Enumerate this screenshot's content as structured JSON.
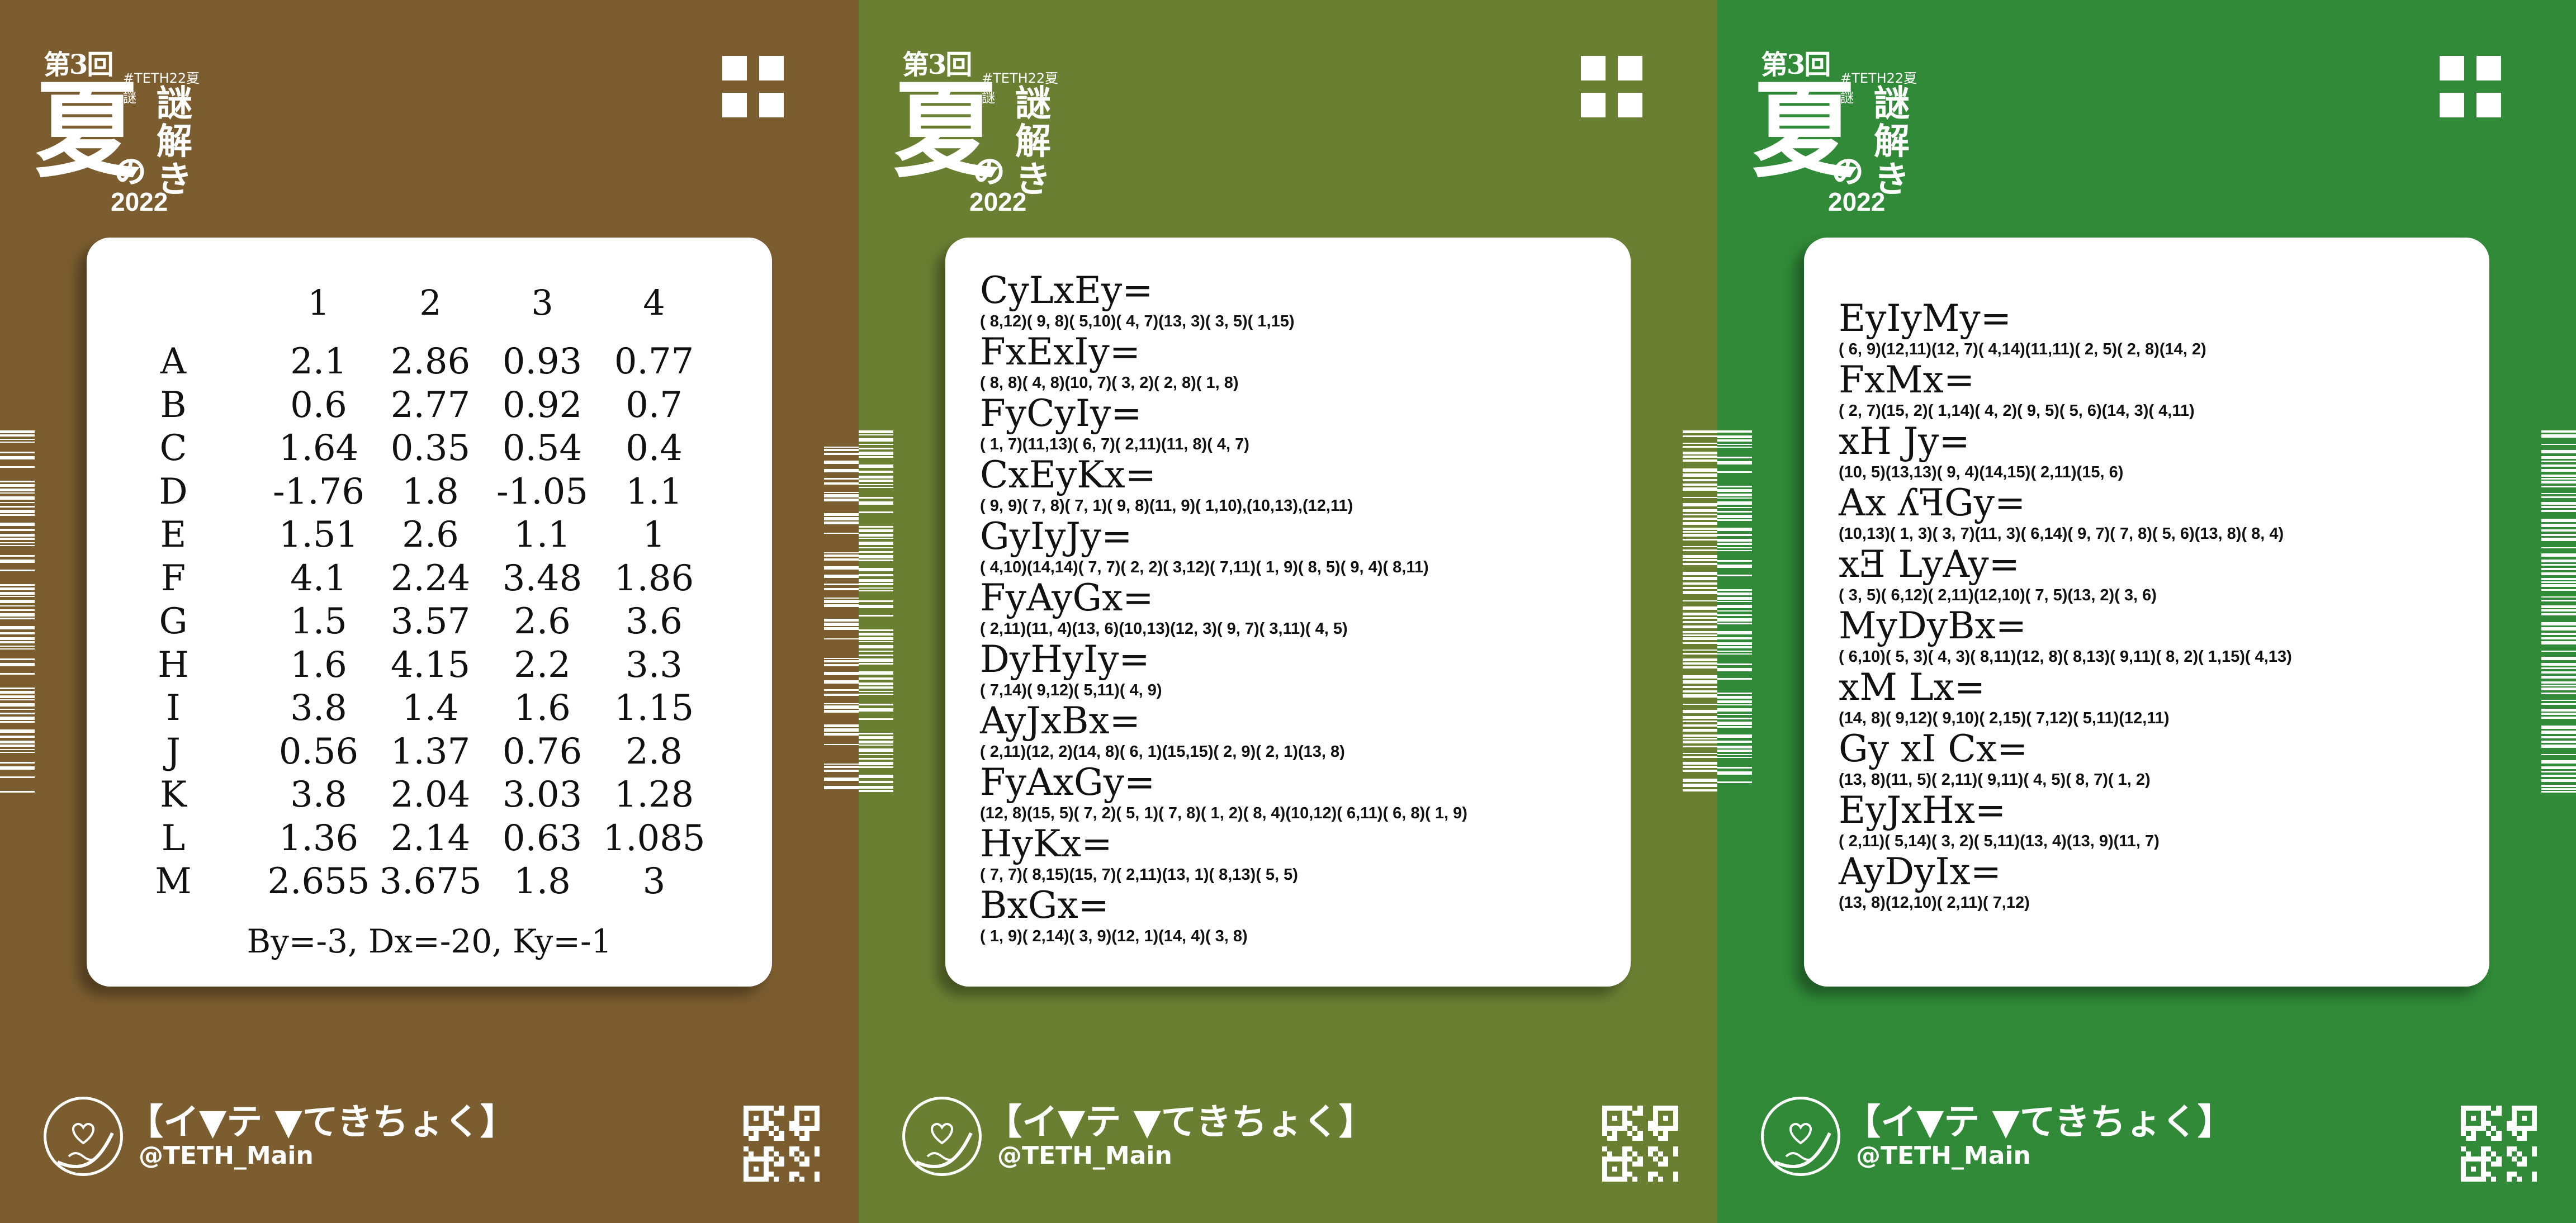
{
  "colors": {
    "card1_bg": "#7b5d30",
    "card2_bg": "#6b7f33",
    "card3_bg": "#308a38"
  },
  "brand": {
    "dai": "第3回",
    "tag": "#TETH22夏謎",
    "natsu": "夏",
    "no": "の",
    "nazo": [
      "謎",
      "解",
      "き"
    ],
    "year": "2022",
    "footer_title": "【イ▼テ ▼てきちょく】",
    "footer_handle": "@TETH_Main"
  },
  "icons": {
    "grid": "grid-icon",
    "badge": "heart-infinity-badge-icon",
    "qr": "qr-code-icon",
    "barcode": "barcode-strip-icon"
  },
  "card1": {
    "columns": [
      "1",
      "2",
      "3",
      "4"
    ],
    "rows": [
      {
        "label": "A",
        "values": [
          "2.1",
          "2.86",
          "0.93",
          "0.77"
        ]
      },
      {
        "label": "B",
        "values": [
          "0.6",
          "2.77",
          "0.92",
          "0.7"
        ]
      },
      {
        "label": "C",
        "values": [
          "1.64",
          "0.35",
          "0.54",
          "0.4"
        ]
      },
      {
        "label": "D",
        "values": [
          "-1.76",
          "1.8",
          "-1.05",
          "1.1"
        ]
      },
      {
        "label": "E",
        "values": [
          "1.51",
          "2.6",
          "1.1",
          "1"
        ]
      },
      {
        "label": "F",
        "values": [
          "4.1",
          "2.24",
          "3.48",
          "1.86"
        ]
      },
      {
        "label": "G",
        "values": [
          "1.5",
          "3.57",
          "2.6",
          "3.6"
        ]
      },
      {
        "label": "H",
        "values": [
          "1.6",
          "4.15",
          "2.2",
          "3.3"
        ]
      },
      {
        "label": "I",
        "values": [
          "3.8",
          "1.4",
          "1.6",
          "1.15"
        ]
      },
      {
        "label": "J",
        "values": [
          "0.56",
          "1.37",
          "0.76",
          "2.8"
        ]
      },
      {
        "label": "K",
        "values": [
          "3.8",
          "2.04",
          "3.03",
          "1.28"
        ]
      },
      {
        "label": "L",
        "values": [
          "1.36",
          "2.14",
          "0.63",
          "1.085"
        ]
      },
      {
        "label": "M",
        "values": [
          "2.655",
          "3.675",
          "1.8",
          "3"
        ]
      }
    ],
    "note": "By=-3, Dx=-20, Ky=-1"
  },
  "card2": {
    "equations": [
      {
        "var": "CyLxEy=",
        "pairs": "( 8,12)( 9, 8)( 5,10)( 4, 7)(13, 3)( 3, 5)( 1,15)"
      },
      {
        "var": "FxExIy=",
        "pairs": "( 8, 8)( 4, 8)(10, 7)( 3, 2)( 2, 8)( 1, 8)"
      },
      {
        "var": "FyCyIy=",
        "pairs": "( 1, 7)(11,13)( 6, 7)( 2,11)(11, 8)( 4, 7)"
      },
      {
        "var": "CxEyKx=",
        "pairs": "( 9, 9)( 7, 8)( 7, 1)( 9, 8)(11, 9)( 1,10),(10,13),(12,11)"
      },
      {
        "var": "GyIyJy=",
        "pairs": "( 4,10)(14,14)( 7, 7)( 2, 2)( 3,12)( 7,11)( 1, 9)( 8, 5)( 9, 4)( 8,11)"
      },
      {
        "var": "FyAyGx=",
        "pairs": "( 2,11)(11, 4)(13, 6)(10,13)(12, 3)( 9, 7)( 3,11)( 4, 5)"
      },
      {
        "var": "DyHyIy=",
        "pairs": "( 7,14)( 9,12)( 5,11)( 4, 9)"
      },
      {
        "var": "AyJxBx=",
        "pairs": "( 2,11)(12, 2)(14, 8)( 6, 1)(15,15)( 2, 9)( 2, 1)(13, 8)"
      },
      {
        "var": "FyAxGy=",
        "pairs": "(12, 8)(15, 5)( 7, 2)( 5, 1)( 7, 8)( 1, 2)( 8, 4)(10,12)( 6,11)( 6, 8)( 1, 9)"
      },
      {
        "var": "HyKx=",
        "pairs": "( 7, 7)( 8,15)(15, 7)( 2,11)(13, 1)( 8,13)( 5, 5)"
      },
      {
        "var": "BxGx=",
        "pairs": "( 1, 9)( 2,14)( 3, 9)(12, 1)(14, 4)( 3, 8)"
      }
    ]
  },
  "card3": {
    "equations": [
      {
        "var": "EyIyMy=",
        "pairs": "( 6, 9)(12,11)(12, 7)( 4,14)(11,11)( 2, 5)( 2, 8)(14, 2)"
      },
      {
        "var": "FxMx=",
        "pairs": "( 2, 7)(15, 2)( 1,14)( 4, 2)( 9, 5)( 5, 6)(14, 3)( 4,11)"
      },
      {
        "var": "xH Jy=",
        "pairs": "(10, 5)(13,13)( 9, 4)(14,15)( 2,11)(15, 6)"
      },
      {
        "var": "Ax ʎꟻGy=",
        "pairs": "(10,13)( 1, 3)( 3, 7)(11, 3)( 6,14)( 9, 7)( 7, 8)( 5, 6)(13, 8)( 8, 4)"
      },
      {
        "var": "xƎ LyAy=",
        "pairs": "( 3, 5)( 6,12)( 2,11)(12,10)( 7, 5)(13, 2)( 3, 6)"
      },
      {
        "var": "MyDyBx=",
        "pairs": "( 6,10)( 5, 3)( 4, 3)( 8,11)(12, 8)( 8,13)( 9,11)( 8, 2)( 1,15)( 4,13)"
      },
      {
        "var": "xM Lx=",
        "pairs": "(14, 8)( 9,12)( 9,10)( 2,15)( 7,12)( 5,11)(12,11)"
      },
      {
        "var": "Gy xI Cx=",
        "pairs": "(13, 8)(11, 5)( 2,11)( 9,11)( 4, 5)( 8, 7)( 1, 2)"
      },
      {
        "var": "EyJxHx=",
        "pairs": "( 2,11)( 5,14)( 3, 2)( 5,11)(13, 4)(13, 9)(11, 7)"
      },
      {
        "var": "AyDyIx=",
        "pairs": "(13, 8)(12,10)( 2,11)( 7,12)"
      }
    ]
  }
}
